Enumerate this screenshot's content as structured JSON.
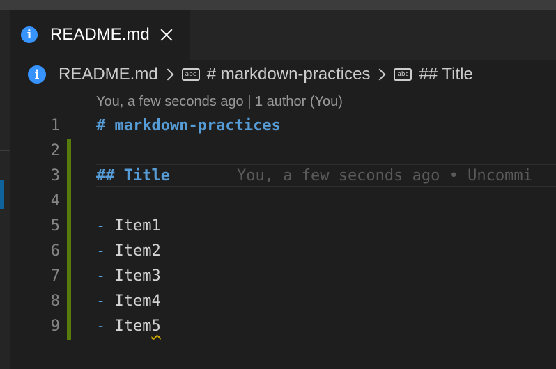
{
  "tab": {
    "label": "README.md"
  },
  "breadcrumb": {
    "file": "README.md",
    "symbol1": "# markdown-practices",
    "symbol2": "## Title",
    "abc_text": "abc"
  },
  "codelens": "You, a few seconds ago | 1 author (You)",
  "blame": "You, a few seconds ago • Uncommi",
  "lines": [
    {
      "number": "1",
      "text": "# markdown-practices"
    },
    {
      "number": "2",
      "text": ""
    },
    {
      "number": "3",
      "text": "## Title"
    },
    {
      "number": "4",
      "text": ""
    },
    {
      "number": "5",
      "dash": "-",
      "text": "Item1"
    },
    {
      "number": "6",
      "dash": "-",
      "text": "Item2"
    },
    {
      "number": "7",
      "dash": "-",
      "text": "Item3"
    },
    {
      "number": "8",
      "dash": "-",
      "text": "Item4"
    },
    {
      "number": "9",
      "dash": "-",
      "text": "Item",
      "squiggled": "5"
    }
  ],
  "colors": {
    "editor_bg": "#1e1e1e",
    "accent_info": "#3794ff",
    "markdown_heading": "#569cd6",
    "diff_added": "#587c0c"
  },
  "icons": [
    "info-icon",
    "close-icon",
    "chevron-right-icon",
    "abc-string-icon"
  ]
}
